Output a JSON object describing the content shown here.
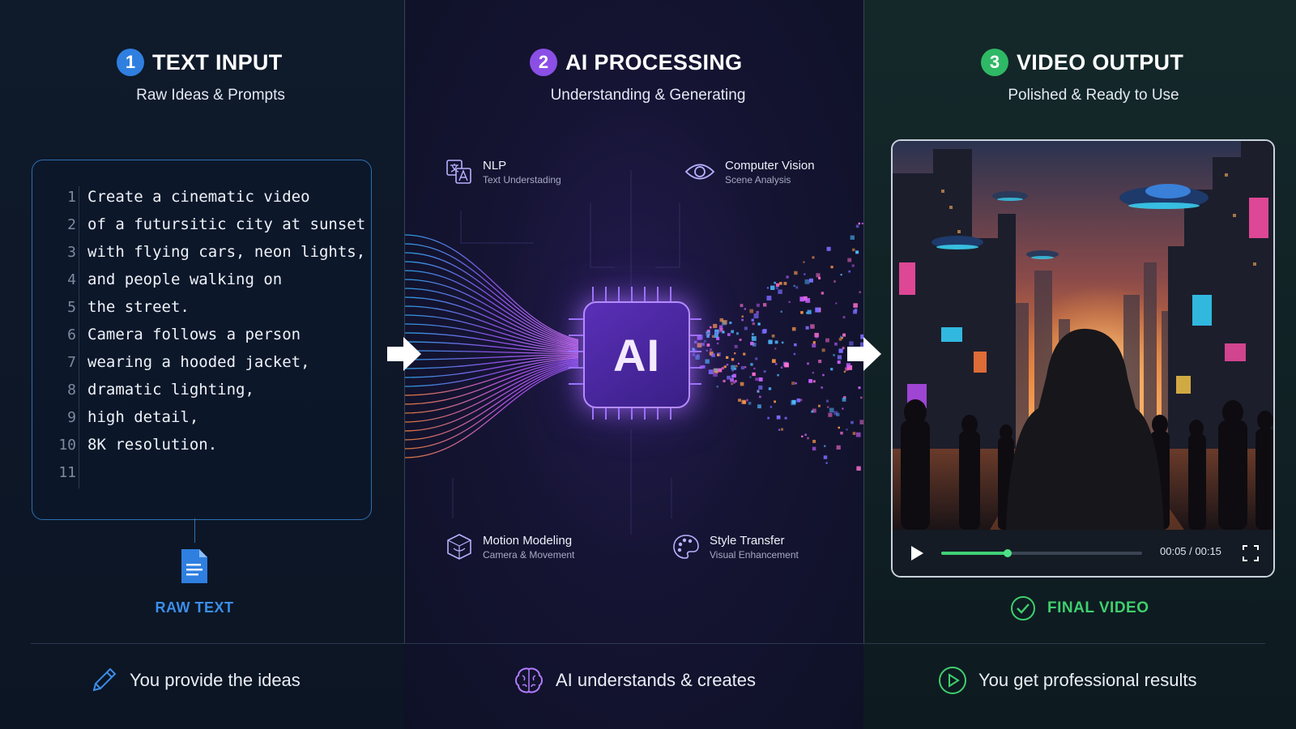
{
  "colors": {
    "step1": "#2f7fe0",
    "step2": "#8b4fe6",
    "step3": "#2fb865",
    "raw_text": "#3b8eea",
    "final_video": "#3fcf6d"
  },
  "steps": [
    {
      "number": "1",
      "title": "TEXT INPUT",
      "subtitle": "Raw Ideas & Prompts"
    },
    {
      "number": "2",
      "title": "AI PROCESSING",
      "subtitle": "Understanding & Generating"
    },
    {
      "number": "3",
      "title": "VIDEO OUTPUT",
      "subtitle": "Polished & Ready to Use"
    }
  ],
  "prompt": {
    "lines": [
      {
        "n": "1",
        "text": "Create a cinematic video"
      },
      {
        "n": "2",
        "text": "of a futursitic city at sunset"
      },
      {
        "n": "3",
        "text": "with flying cars, neon lights,"
      },
      {
        "n": "4",
        "text": "and people walking on"
      },
      {
        "n": "5",
        "text": "the street."
      },
      {
        "n": "6",
        "text": "Camera follows a person"
      },
      {
        "n": "7",
        "text": "wearing a hooded jacket,"
      },
      {
        "n": "8",
        "text": "dramatic lighting,"
      },
      {
        "n": "9",
        "text": "high detail,"
      },
      {
        "n": "10",
        "text": "8K resolution."
      },
      {
        "n": "11",
        "text": ""
      }
    ],
    "label": "RAW TEXT"
  },
  "processing": {
    "chip_label": "AI",
    "modules": [
      {
        "title": "NLP",
        "subtitle": "Text Understading",
        "icon": "translate-icon"
      },
      {
        "title": "Computer Vision",
        "subtitle": "Scene Analysis",
        "icon": "eye-icon"
      },
      {
        "title": "Motion Modeling",
        "subtitle": "Camera & Movement",
        "icon": "cube-icon"
      },
      {
        "title": "Style Transfer",
        "subtitle": "Visual Enhancement",
        "icon": "palette-icon"
      }
    ]
  },
  "video": {
    "time": "00:05 / 00:15",
    "progress": 0.33,
    "label": "FINAL VIDEO"
  },
  "footer": [
    {
      "text": "You provide the ideas",
      "icon": "pencil-icon"
    },
    {
      "text": "AI understands & creates",
      "icon": "brain-icon"
    },
    {
      "text": "You get professional results",
      "icon": "play-circle-icon"
    }
  ]
}
